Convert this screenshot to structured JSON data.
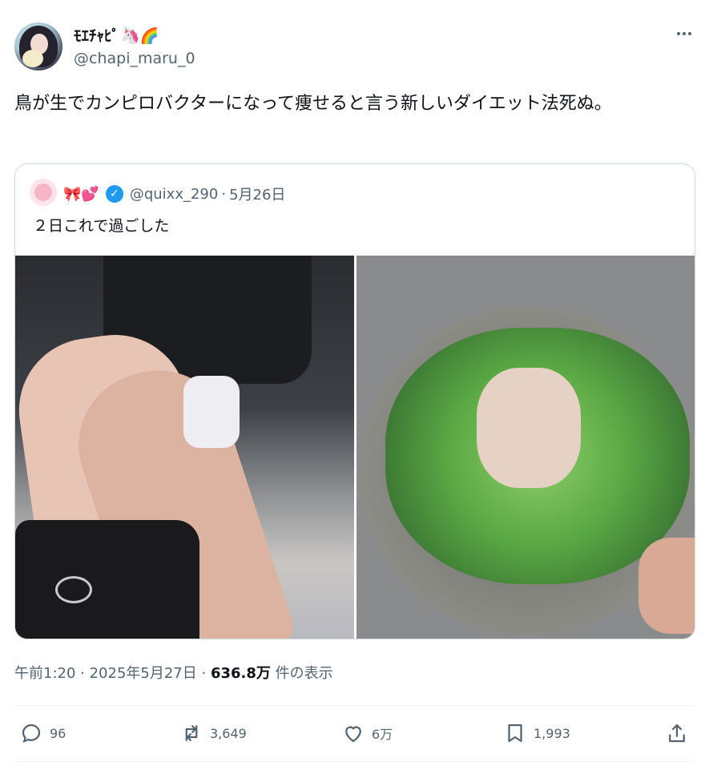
{
  "author": {
    "display_name": "ﾓｴﾁｬﾋﾟ",
    "name_emojis": "🦄🌈",
    "handle": "@chapi_maru_0"
  },
  "tweet": {
    "text": "鳥が生でカンピロバクターになって痩せると言う新しいダイエット法死ぬ。"
  },
  "quote": {
    "name_emojis": "🎀💕",
    "handle": "@quixx_290",
    "dot": " · ",
    "date": "5月26日",
    "text": "２日これで過ごした"
  },
  "meta": {
    "time": "午前1:20",
    "sep1": " · ",
    "date": "2025年5月27日",
    "sep2": " · ",
    "views": "636.8万",
    "views_label": " 件の表示"
  },
  "actions": {
    "replies": "96",
    "retweets": "3,649",
    "likes": "6万",
    "bookmarks": "1,993"
  },
  "icons": [
    "more-icon",
    "verified-icon",
    "reply-icon",
    "retweet-icon",
    "like-icon",
    "bookmark-icon",
    "share-icon"
  ],
  "colors": {
    "verified": "#1d9bf0",
    "secondary_text": "#536471",
    "border": "#cfd9de"
  }
}
